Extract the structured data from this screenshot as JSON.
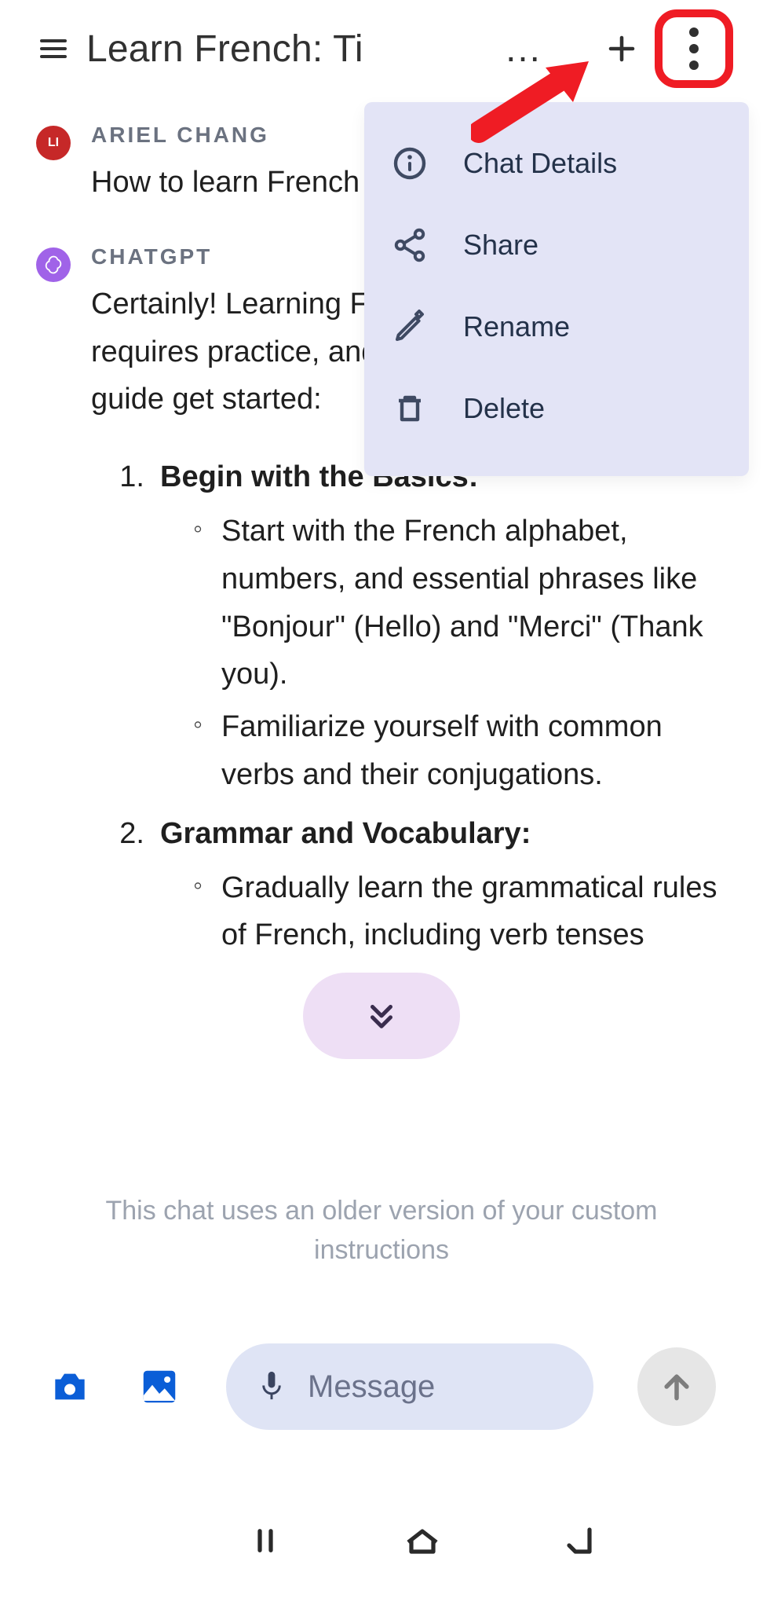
{
  "header": {
    "title": "Learn French: Ti",
    "ellipsis": "…"
  },
  "menu": {
    "items": [
      {
        "label": "Chat Details"
      },
      {
        "label": "Share"
      },
      {
        "label": "Rename"
      },
      {
        "label": "Delete"
      }
    ]
  },
  "user": {
    "avatar_initials": "LI",
    "name": "ARIEL CHANG",
    "message": "How to learn French"
  },
  "assistant": {
    "name": "CHATGPT",
    "intro": "Certainly! Learning French, other language, requires practice, and the right Here's a concise guide get started:",
    "list": [
      {
        "n": "1.",
        "title": "Begin with the Basics:",
        "bullets": [
          "Start with the French alphabet, numbers, and essential phrases like \"Bonjour\" (Hello) and \"Merci\" (Thank you).",
          "Familiarize yourself with common verbs and their conjugations."
        ]
      },
      {
        "n": "2.",
        "title": "Grammar and Vocabulary:",
        "bullets": [
          "Gradually learn the grammatical rules of French, including verb tenses"
        ]
      }
    ]
  },
  "notice": "This chat uses an older version of your custom instructions",
  "input": {
    "placeholder": "Message"
  }
}
